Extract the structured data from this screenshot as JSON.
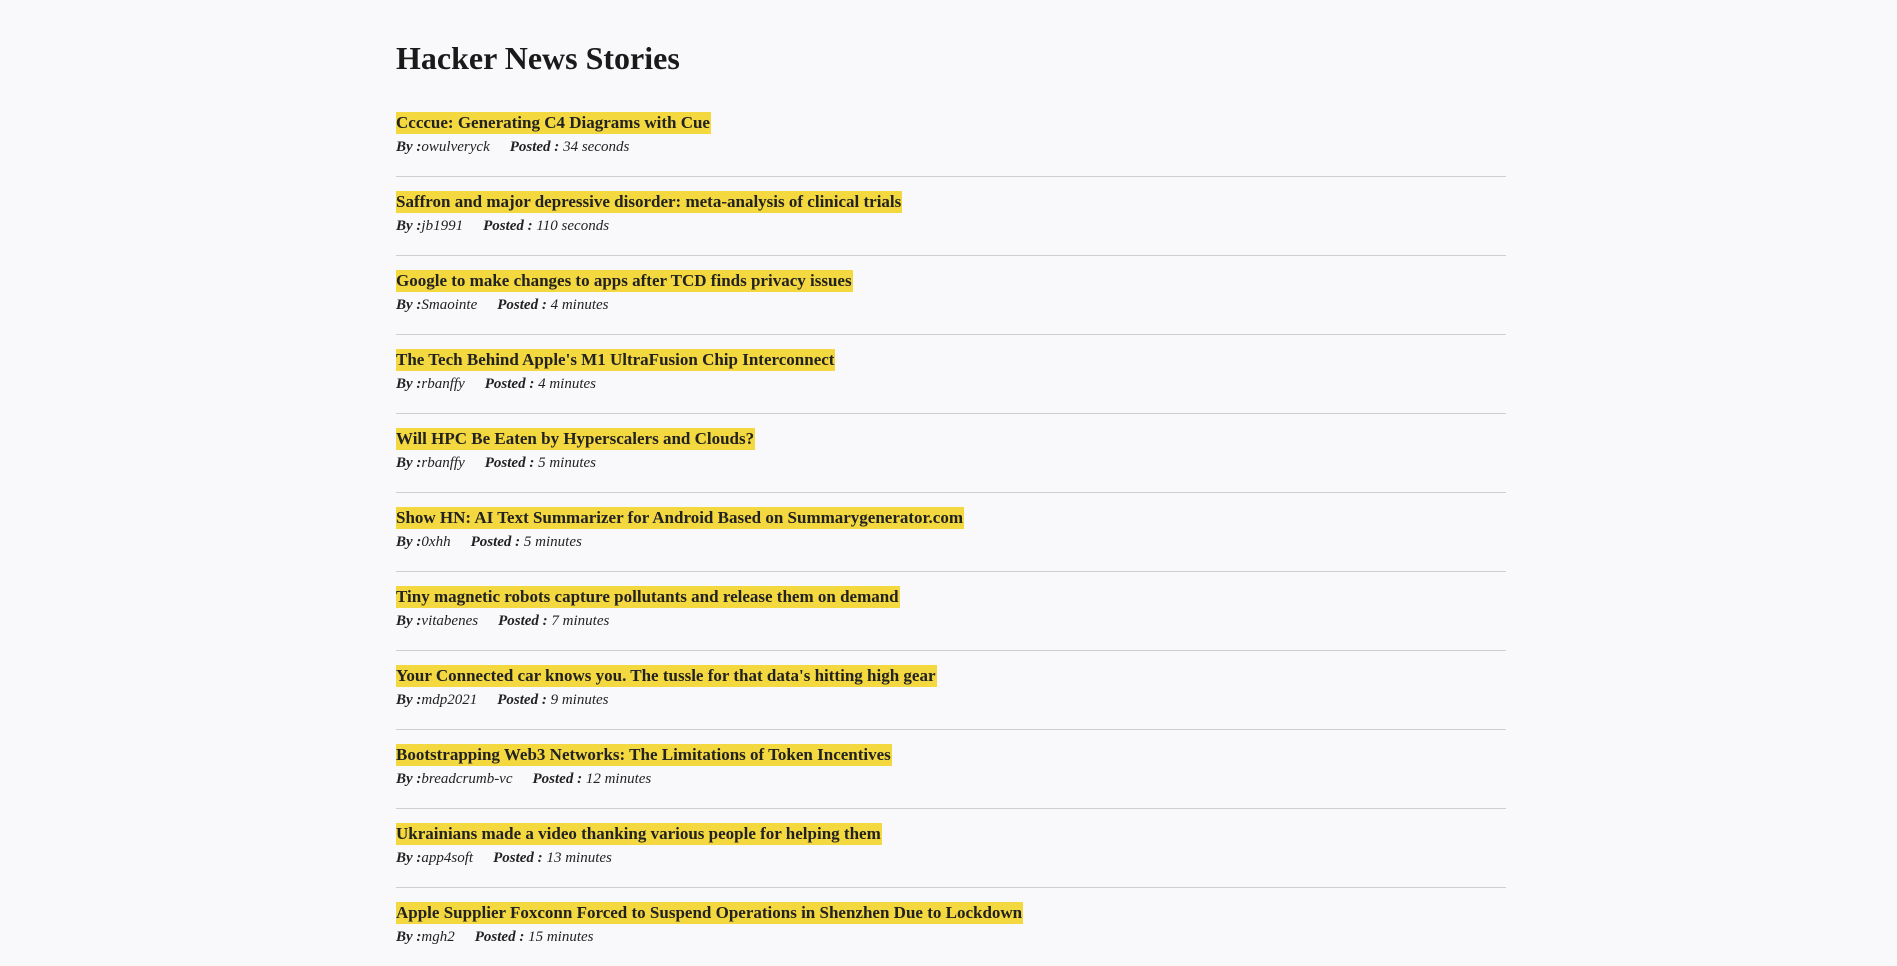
{
  "page": {
    "title": "Hacker News Stories",
    "by_label": "By :",
    "posted_label": "Posted :"
  },
  "colors": {
    "highlight": "#f4d83f",
    "divider": "#cfcfcf",
    "background": "#f9f9fc"
  },
  "stories": [
    {
      "title": "Ccccue: Generating C4 Diagrams with Cue",
      "author": "owulveryck",
      "posted": "34 seconds"
    },
    {
      "title": "Saffron and major depressive disorder: meta-analysis of clinical trials",
      "author": "jb1991",
      "posted": "110 seconds"
    },
    {
      "title": "Google to make changes to apps after TCD finds privacy issues",
      "author": "Smaointe",
      "posted": "4 minutes"
    },
    {
      "title": "The Tech Behind Apple's M1 UltraFusion Chip Interconnect",
      "author": "rbanffy",
      "posted": "4 minutes"
    },
    {
      "title": "Will HPC Be Eaten by Hyperscalers and Clouds?",
      "author": "rbanffy",
      "posted": "5 minutes"
    },
    {
      "title": "Show HN: AI Text Summarizer for Android Based on Summarygenerator.com",
      "author": "0xhh",
      "posted": "5 minutes"
    },
    {
      "title": "Tiny magnetic robots capture pollutants and release them on demand",
      "author": "vitabenes",
      "posted": "7 minutes"
    },
    {
      "title": "Your Connected car knows you. The tussle for that data's hitting high gear",
      "author": "mdp2021",
      "posted": "9 minutes"
    },
    {
      "title": "Bootstrapping Web3 Networks: The Limitations of Token Incentives",
      "author": "breadcrumb-vc",
      "posted": "12 minutes"
    },
    {
      "title": "Ukrainians made a video thanking various people for helping them",
      "author": "app4soft",
      "posted": "13 minutes"
    },
    {
      "title": "Apple Supplier Foxconn Forced to Suspend Operations in Shenzhen Due to Lockdown",
      "author": "mgh2",
      "posted": "15 minutes"
    }
  ]
}
